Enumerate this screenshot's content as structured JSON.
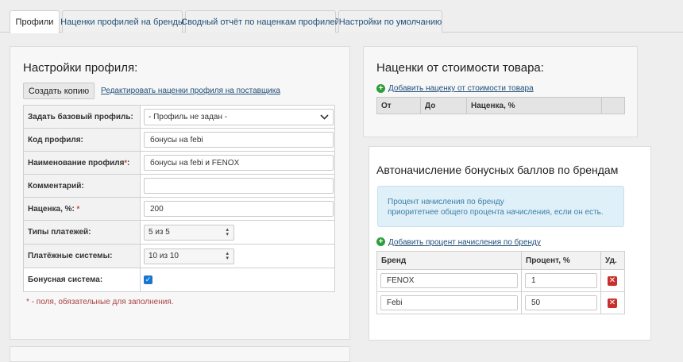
{
  "tabs": [
    {
      "label": "Профили",
      "active": true
    },
    {
      "label": "Наценки профилей на бренды",
      "active": false
    },
    {
      "label": "Сводный отчёт по наценкам профилей",
      "active": false
    },
    {
      "label": "Настройки по умолчанию",
      "active": false
    }
  ],
  "profile_settings": {
    "title": "Настройки профиля:",
    "copy_button": "Создать копию",
    "edit_link": "Редактировать наценки профиля на поставщика",
    "fields": {
      "base_profile": {
        "label": "Задать базовый профиль:",
        "value": "- Профиль не задан -"
      },
      "code": {
        "label": "Код профиля:",
        "value": "бонусы на febi"
      },
      "name": {
        "label": "Наименование профиля",
        "required": "*",
        "colon": ":",
        "value": "бонусы на febi и FENOX"
      },
      "comment": {
        "label": "Комментарий:",
        "value": ""
      },
      "markup": {
        "label": "Наценка, %:",
        "required": "*",
        "value": "200"
      },
      "payment_types": {
        "label": "Типы платежей:",
        "value": "5 из 5"
      },
      "payment_systems": {
        "label": "Платёжные системы:",
        "value": "10 из 10"
      },
      "bonus_system": {
        "label": "Бонусная система:",
        "checked": true
      }
    },
    "required_note": "* - поля, обязательные для заполнения."
  },
  "price_markup": {
    "title": "Наценки от стоимости товара:",
    "add_link": "Добавить наценку от стоимости товара",
    "columns": [
      "От",
      "До",
      "Наценка, %",
      ""
    ]
  },
  "bonus_accrual": {
    "title": "Автоначисление бонусных баллов по брендам",
    "info_line1": "Процент начисления по бренду",
    "info_line2": "приоритетнее общего процента начисления, если он есть.",
    "add_link": "Добавить процент начисления по бренду",
    "columns": {
      "brand": "Бренд",
      "percent": "Процент, %",
      "del": "Уд."
    },
    "rows": [
      {
        "brand": "FENOX",
        "percent": "1"
      },
      {
        "brand": "Febi",
        "percent": "50"
      }
    ]
  }
}
